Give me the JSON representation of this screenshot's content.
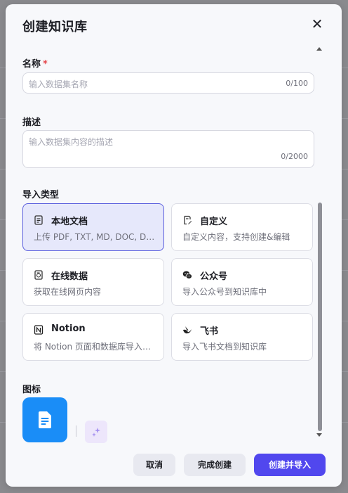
{
  "dialog": {
    "title": "创建知识库",
    "close_label": "✕"
  },
  "name_field": {
    "label": "名称",
    "required_mark": "*",
    "placeholder": "输入数据集名称",
    "counter": "0/100"
  },
  "description_field": {
    "label": "描述",
    "placeholder": "输入数据集内容的描述",
    "counter": "0/2000"
  },
  "import_type": {
    "label": "导入类型",
    "options": [
      {
        "title": "本地文档",
        "desc": "上传 PDF, TXT, MD, DOC, DOCX",
        "icon": "document-icon",
        "selected": true
      },
      {
        "title": "自定义",
        "desc": "自定义内容，支持创建&编辑",
        "icon": "edit-doc-icon",
        "selected": false
      },
      {
        "title": "在线数据",
        "desc": "获取在线网页内容",
        "icon": "web-doc-icon",
        "selected": false
      },
      {
        "title": "公众号",
        "desc": "导入公众号到知识库中",
        "icon": "wechat-icon",
        "selected": false
      },
      {
        "title": "Notion",
        "desc": "将 Notion 页面和数据库导入知识库",
        "icon": "notion-icon",
        "selected": false
      },
      {
        "title": "飞书",
        "desc": "导入飞书文档到知识库",
        "icon": "feishu-icon",
        "selected": false
      }
    ]
  },
  "icon_section": {
    "label": "图标",
    "tile_color": "#1a8df7"
  },
  "footer": {
    "cancel_label": "取消",
    "finish_label": "完成创建",
    "create_import_label": "创建并导入"
  },
  "colors": {
    "accent": "#5147ee",
    "selected_card_bg": "#e6e8fb",
    "required": "#e5484d"
  }
}
